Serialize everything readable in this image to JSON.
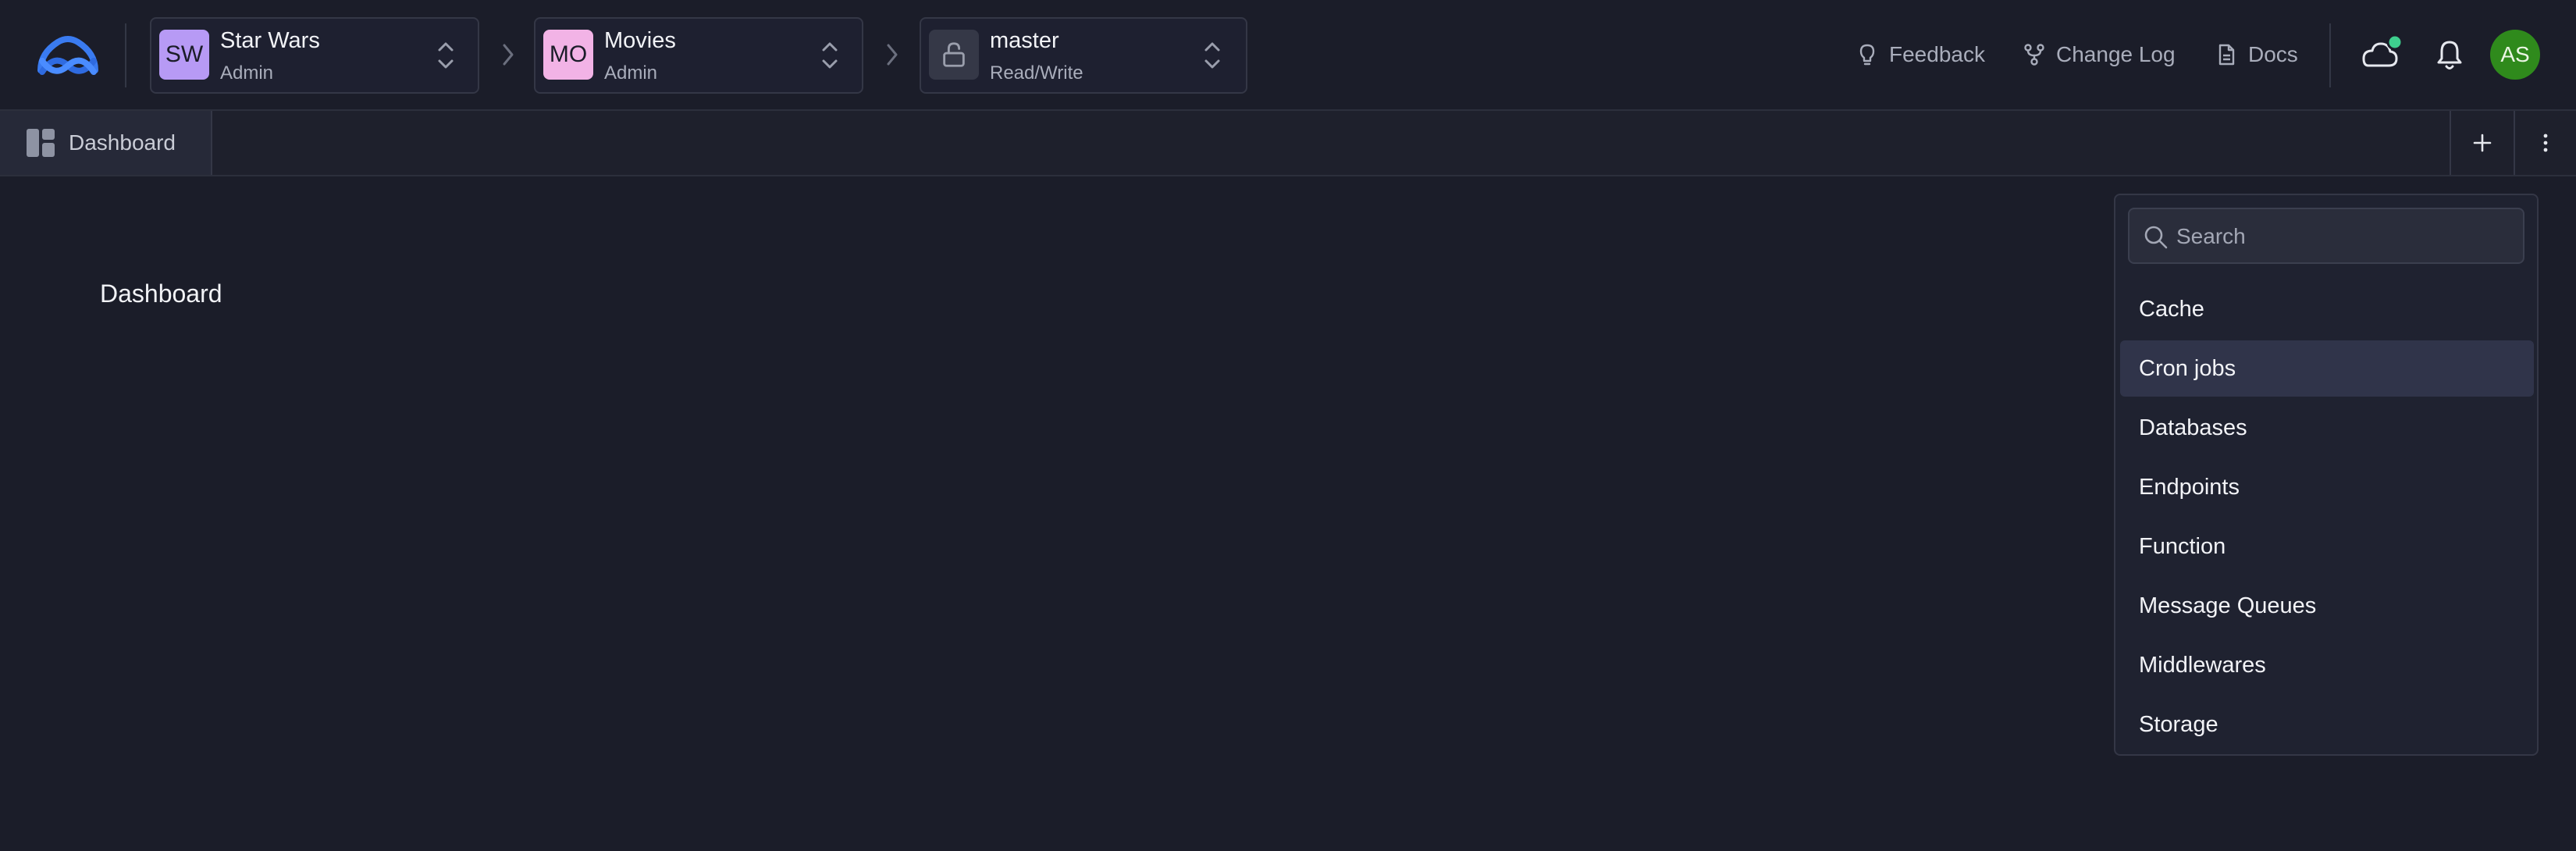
{
  "colors": {
    "background": "#1b1d29",
    "org_avatar": "#b79af5",
    "project_avatar": "#f2b3e6",
    "user_avatar": "#2f8a1c",
    "status_dot": "#3ecf8e",
    "active_item": "#30344a"
  },
  "header": {
    "org": {
      "initials": "SW",
      "name": "Star Wars",
      "role": "Admin"
    },
    "project": {
      "initials": "MO",
      "name": "Movies",
      "role": "Admin"
    },
    "branch": {
      "name": "master",
      "access": "Read/Write",
      "icon": "lock-open-icon"
    },
    "links": [
      {
        "label": "Feedback",
        "icon": "lightbulb-icon"
      },
      {
        "label": "Change Log",
        "icon": "git-branch-icon"
      },
      {
        "label": "Docs",
        "icon": "document-icon"
      }
    ],
    "user_initials": "AS"
  },
  "tabs": [
    {
      "label": "Dashboard",
      "icon": "dashboard-icon"
    }
  ],
  "main": {
    "title": "Dashboard"
  },
  "dropdown": {
    "search_placeholder": "Search",
    "items": [
      {
        "label": "Cache"
      },
      {
        "label": "Cron jobs",
        "highlighted": true
      },
      {
        "label": "Databases"
      },
      {
        "label": "Endpoints"
      },
      {
        "label": "Function"
      },
      {
        "label": "Message Queues"
      },
      {
        "label": "Middlewares"
      },
      {
        "label": "Storage"
      }
    ]
  }
}
